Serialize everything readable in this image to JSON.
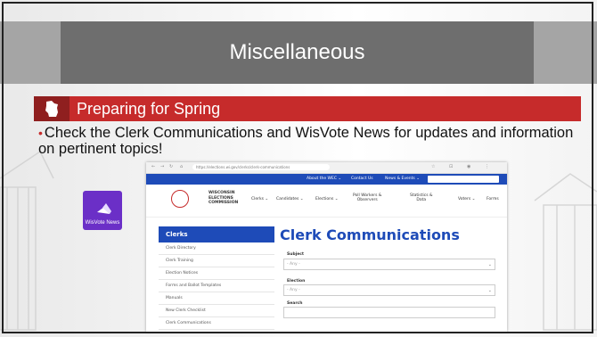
{
  "title": "Miscellaneous",
  "subheading": "Preparing for Spring",
  "bullet": "Check the Clerk Communications and WisVote News for updates and information on pertinent topics!",
  "wisvote_tile": {
    "label": "WisVote News",
    "icon": "megaphone-icon",
    "color": "#6b2fc7"
  },
  "colors": {
    "title_bar": "#6e6e6e",
    "accent_red": "#c62b2b",
    "site_blue": "#1e4bb8"
  },
  "website": {
    "url": "https://elections.wi.gov/clerks/clerk-communications",
    "top_nav": [
      "About the WEC ⌄",
      "Contact Us",
      "News & Events ⌄"
    ],
    "search_icon": "search-icon",
    "org_name": [
      "WISCONSIN",
      "ELECTIONS",
      "COMMISSION"
    ],
    "main_nav": [
      "Clerks ⌄",
      "Candidates ⌄",
      "Elections ⌄",
      "Poll Workers &\nObservers",
      "Statistics &\nData",
      "Voters ⌄",
      "Forms"
    ],
    "page_title": "Clerk Communications",
    "sidebar": {
      "heading": "Clerks",
      "items": [
        "Clerk Directory",
        "Clerk Training",
        "Election Notices",
        "Forms and Ballot Templates",
        "Manuals",
        "New Clerk Checklist",
        "Clerk Communications"
      ]
    },
    "filters": {
      "subject_label": "Subject",
      "subject_value": "- Any -",
      "election_label": "Election",
      "election_value": "- Any -",
      "search_label": "Search"
    }
  }
}
